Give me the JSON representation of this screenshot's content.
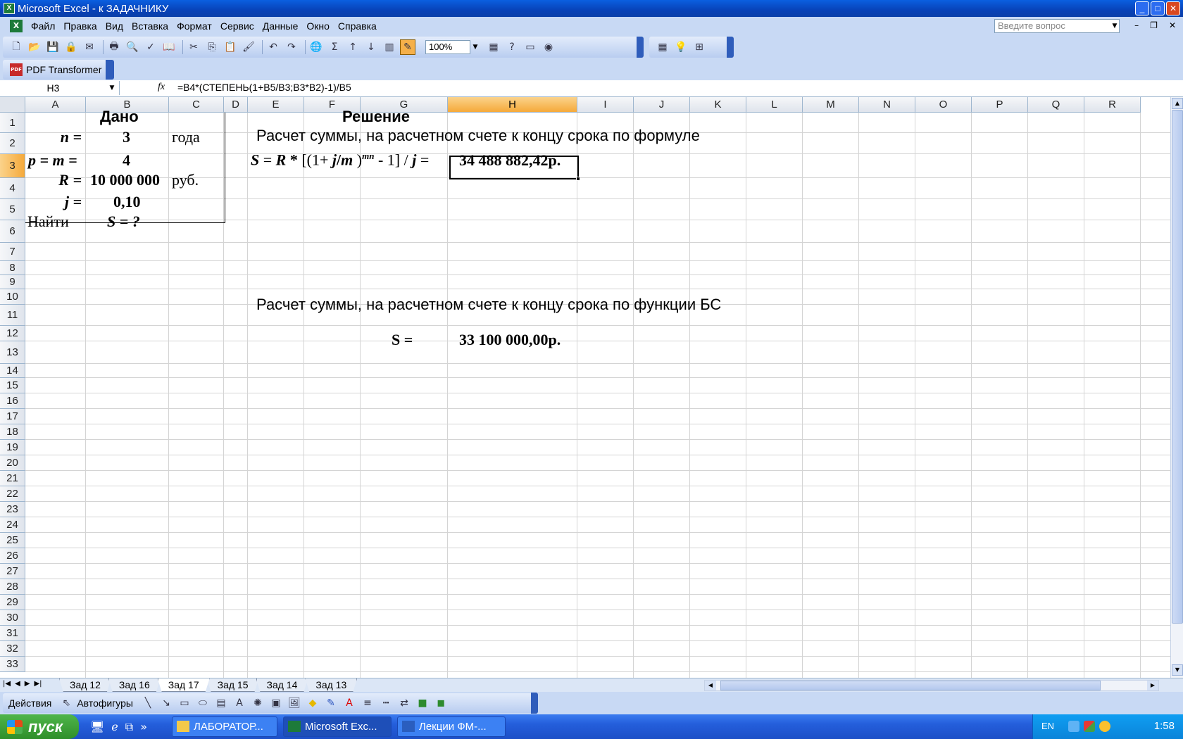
{
  "window": {
    "title": "Microsoft Excel - к ЗАДАЧНИКУ",
    "min": "_",
    "max": "□",
    "close": "✕"
  },
  "menu": {
    "items": [
      "Файл",
      "Правка",
      "Вид",
      "Вставка",
      "Формат",
      "Сервис",
      "Данные",
      "Окно",
      "Справка"
    ],
    "ask_placeholder": "Введите вопрос"
  },
  "toolbar": {
    "zoom": "100%"
  },
  "pdfbar": {
    "label": "PDF Transformer"
  },
  "formula_bar": {
    "name_box": "H3",
    "fx": "fx",
    "formula": "=B4*(СТЕПЕНЬ(1+B5/B3;B3*B2)-1)/B5"
  },
  "columns": [
    "A",
    "B",
    "C",
    "D",
    "E",
    "F",
    "G",
    "H",
    "I",
    "J",
    "K",
    "L",
    "M",
    "N",
    "O",
    "P",
    "Q",
    "R"
  ],
  "selected_column": "H",
  "rows": [
    "1",
    "2",
    "3",
    "4",
    "5",
    "6",
    "7",
    "8",
    "9",
    "10",
    "11",
    "12",
    "13",
    "14",
    "15",
    "16",
    "17",
    "18",
    "19",
    "20",
    "21",
    "22",
    "23",
    "24",
    "25",
    "26",
    "27",
    "28",
    "29",
    "30",
    "31",
    "32",
    "33"
  ],
  "selected_row": "3",
  "cells": {
    "given_title": "Дано",
    "solution_title": "Решение",
    "n_label": "n =",
    "n_value": "3",
    "n_unit": "года",
    "pm_label": "p = m =",
    "pm_value": "4",
    "r_label": "R =",
    "r_value": "10 000 000",
    "r_unit": "руб.",
    "j_label": "j =",
    "j_value": "0,10",
    "find_label": "Найти",
    "find_value": "S = ?",
    "formula_heading": "Расчет суммы, на расчетном счете к концу срока по формуле",
    "formula_text": {
      "s": "S",
      "eq": " = ",
      "r": "R",
      "star": " * ",
      "open": "[(1+ ",
      "j": "j",
      "slash": "/",
      "m": "m",
      "close": " )",
      "exp": "mn",
      "tail": " - 1] / ",
      "j2": "j",
      "end": " ="
    },
    "formula_result": "34 488 882,42р.",
    "bs_heading": "Расчет суммы, на расчетном счете к концу срока по функции БС",
    "bs_label": "S  =",
    "bs_result": "33 100 000,00р."
  },
  "sheet_tabs": [
    "Зад 12",
    "Зад 16",
    "Зад 17",
    "Зад 15",
    "Зад 14",
    "Зад 13"
  ],
  "active_tab": "Зад 17",
  "drawing_toolbar": {
    "actions": "Действия",
    "autoshapes": "Автофигуры"
  },
  "taskbar": {
    "start": "пуск",
    "tasks": [
      "ЛАБОРАТОР...",
      "Microsoft Exc...",
      "Лекции ФМ-..."
    ],
    "lang": "EN",
    "clock": "1:58"
  }
}
